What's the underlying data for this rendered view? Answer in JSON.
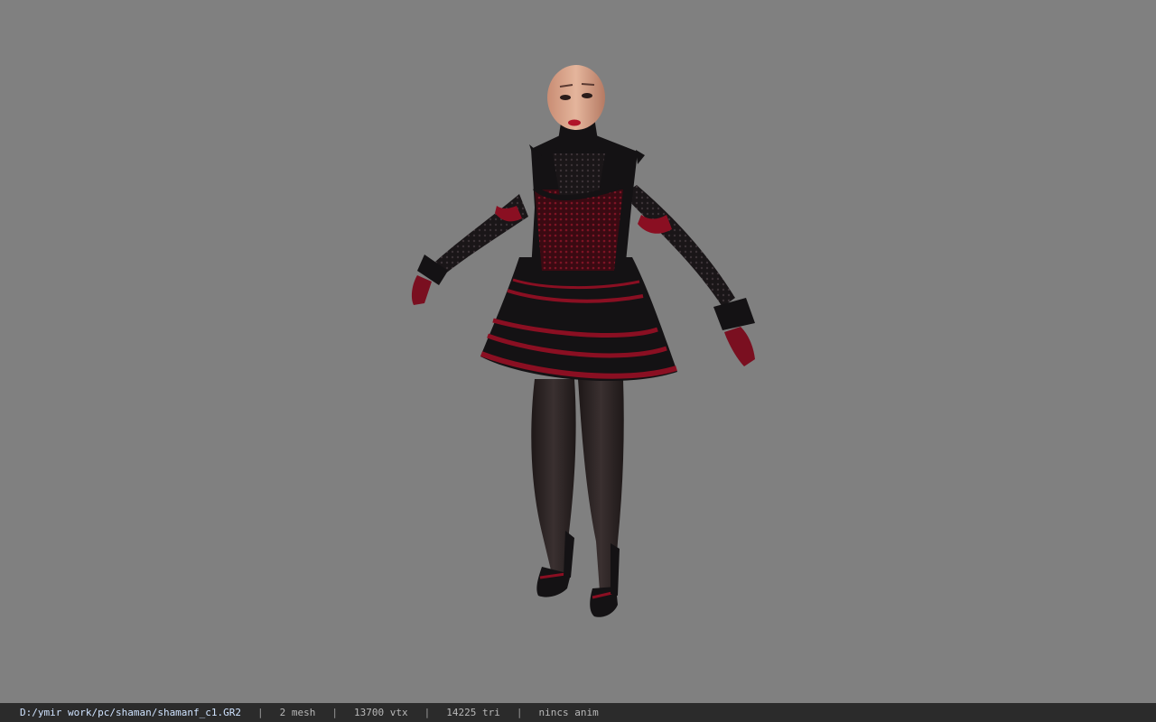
{
  "viewport": {
    "background_color": "#808080",
    "model_label": "shaman female character model"
  },
  "statusbar": {
    "file_path": "D:/ymir work/pc/shaman/shamanf_c1.GR2",
    "mesh": "2 mesh",
    "vertices": "13700 vtx",
    "triangles": "14225 tri",
    "animation": "nincs anim",
    "separator": "|"
  },
  "colors": {
    "statusbar_bg": "#2b2b2b",
    "dress_black": "#141214",
    "dress_red": "#8a0f22",
    "skin": "#d8a58c",
    "stockings": "#2e2626"
  }
}
